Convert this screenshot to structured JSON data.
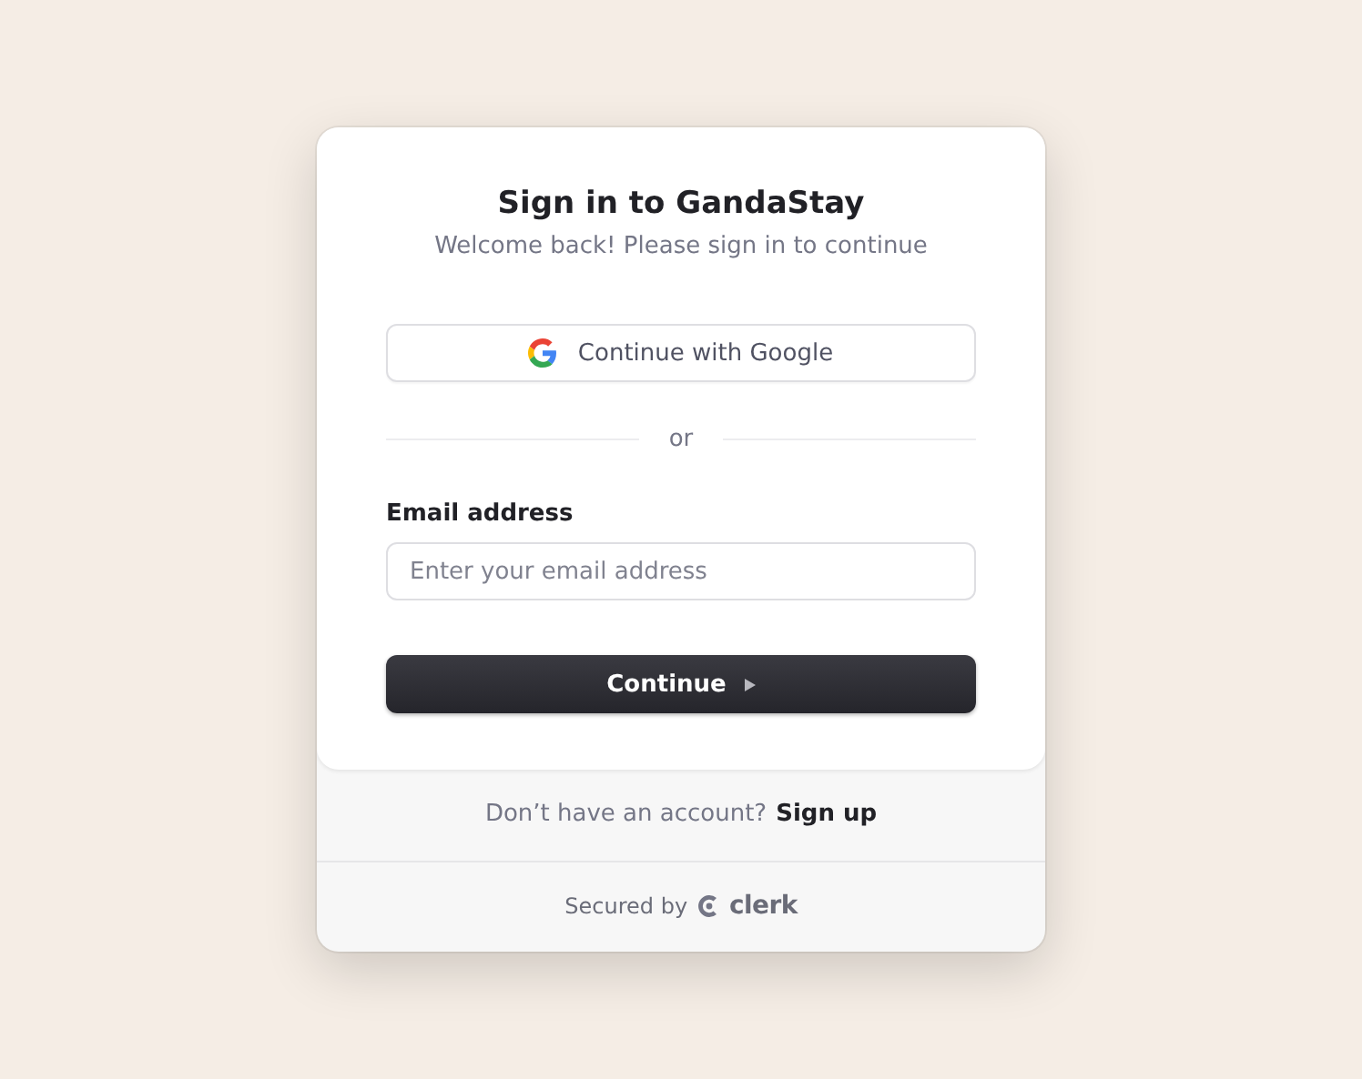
{
  "card": {
    "title": "Sign in to GandaStay",
    "subtitle": "Welcome back! Please sign in to continue"
  },
  "social_button": {
    "label": "Continue with Google"
  },
  "divider": {
    "label": "or"
  },
  "email_field": {
    "label": "Email address",
    "placeholder": "Enter your email address"
  },
  "continue_button": {
    "label": "Continue"
  },
  "footer": {
    "prompt": "Don’t have an account?",
    "link": "Sign up",
    "secured_by": "Secured by",
    "brand": "clerk"
  }
}
